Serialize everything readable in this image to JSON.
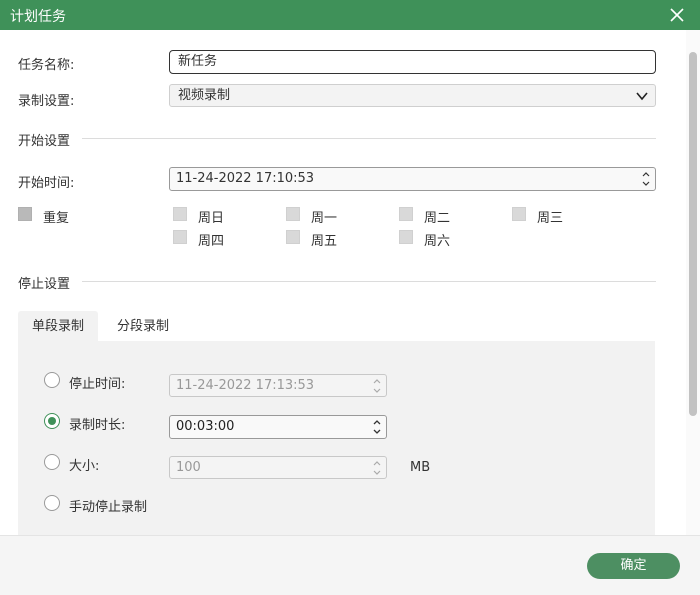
{
  "window": {
    "title": "计划任务"
  },
  "task_name": {
    "label": "任务名称:",
    "value": "新任务"
  },
  "record_setting": {
    "label": "录制设置:",
    "value": "视频录制"
  },
  "start_section": {
    "title": "开始设置"
  },
  "start_time": {
    "label": "开始时间:",
    "value": "11-24-2022 17:10:53"
  },
  "repeat": {
    "label": "重复",
    "days": [
      "周日",
      "周一",
      "周二",
      "周三",
      "周四",
      "周五",
      "周六"
    ]
  },
  "stop_section": {
    "title": "停止设置"
  },
  "tabs": {
    "single": "单段录制",
    "segment": "分段录制"
  },
  "stop_options": {
    "stop_time": {
      "label": "停止时间:",
      "value": "11-24-2022 17:13:53"
    },
    "duration": {
      "label": "录制时长:",
      "value": "00:03:00"
    },
    "size": {
      "label": "大小:",
      "value": "100",
      "unit": "MB"
    },
    "manual": {
      "label": "手动停止录制"
    }
  },
  "footer": {
    "ok_label": "确定"
  },
  "colors": {
    "accent": "#3f9159",
    "button": "#4d8f62"
  },
  "icons": {
    "close": "close-icon",
    "dropdown": "chevron-down-icon",
    "spin": "spin-arrows-icon"
  }
}
